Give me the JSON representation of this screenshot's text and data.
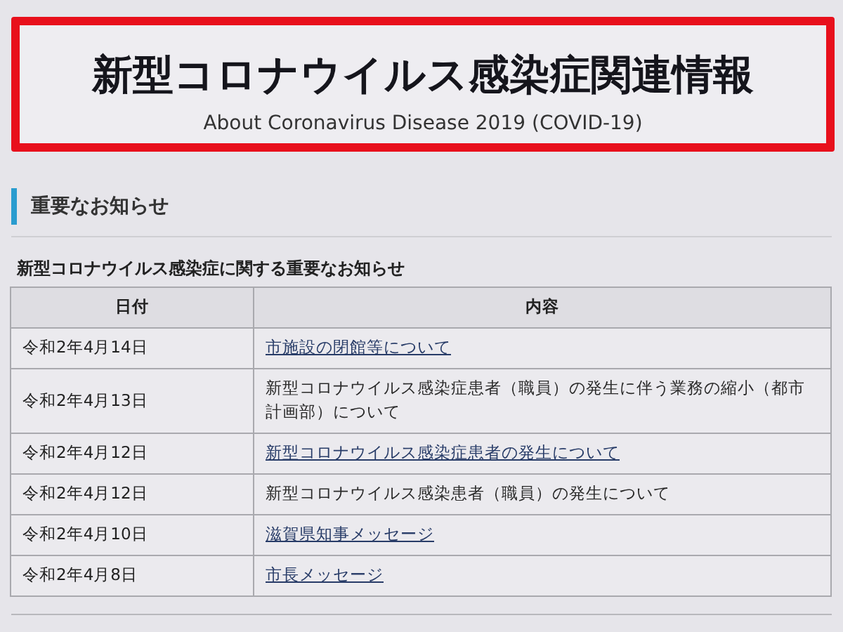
{
  "banner": {
    "title": "新型コロナウイルス感染症関連情報",
    "subtitle": "About Coronavirus Disease 2019 (COVID-19)"
  },
  "section": {
    "heading": "重要なお知らせ",
    "caption": "新型コロナウイルス感染症に関する重要なお知らせ"
  },
  "table": {
    "columns": [
      "日付",
      "内容"
    ],
    "rows": [
      {
        "date": "令和2年4月14日",
        "content": "市施設の閉館等について",
        "link": true
      },
      {
        "date": "令和2年4月13日",
        "content": "新型コロナウイルス感染症患者（職員）の発生に伴う業務の縮小（都市計画部）について",
        "link": false
      },
      {
        "date": "令和2年4月12日",
        "content": "新型コロナウイルス感染症患者の発生について",
        "link": true
      },
      {
        "date": "令和2年4月12日",
        "content": "新型コロナウイルス感染患者（職員）の発生について",
        "link": false
      },
      {
        "date": "令和2年4月10日",
        "content": "滋賀県知事メッセージ",
        "link": true
      },
      {
        "date": "令和2年4月8日",
        "content": "市長メッセージ",
        "link": true
      }
    ]
  }
}
